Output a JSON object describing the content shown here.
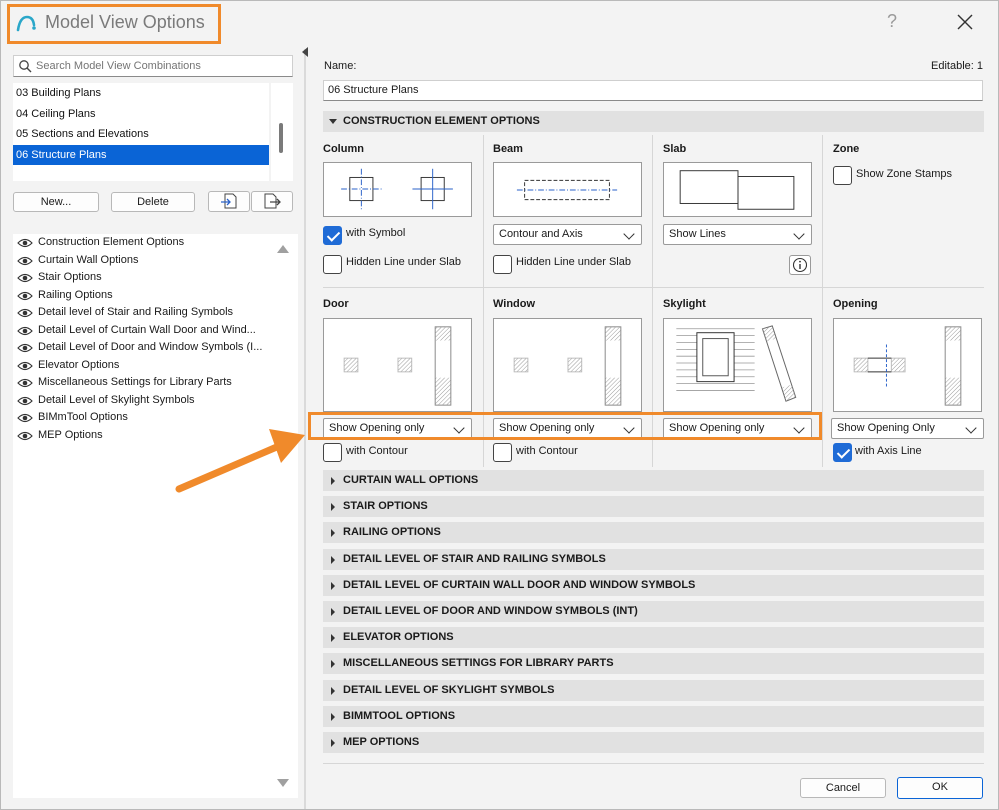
{
  "window": {
    "title": "Model View Options",
    "help_label": "?"
  },
  "search": {
    "placeholder": "Search Model View Combinations",
    "value": ""
  },
  "combinations": [
    {
      "label": "03 Building Plans",
      "selected": false
    },
    {
      "label": "04 Ceiling Plans",
      "selected": false
    },
    {
      "label": "05 Sections and Elevations",
      "selected": false
    },
    {
      "label": "06 Structure Plans",
      "selected": true
    }
  ],
  "buttons": {
    "new_label": "New...",
    "delete_label": "Delete",
    "import_icon": "import-icon",
    "export_icon": "export-icon"
  },
  "option_list": [
    "Construction Element Options",
    "Curtain Wall Options",
    "Stair Options",
    "Railing Options",
    "Detail level of Stair and Railing Symbols",
    "Detail Level of Curtain Wall Door and Wind...",
    "Detail Level of Door and Window Symbols (I...",
    "Elevator Options",
    "Miscellaneous Settings for Library Parts",
    "Detail Level of Skylight Symbols",
    "BIMmTool Options",
    "MEP Options"
  ],
  "name_label": "Name:",
  "editable_label": "Editable: 1",
  "name_value": "06 Structure Plans",
  "construction": {
    "header": "CONSTRUCTION ELEMENT OPTIONS",
    "column": {
      "title": "Column",
      "with_symbol": "with Symbol",
      "with_symbol_checked": true,
      "hidden_line": "Hidden Line under Slab",
      "hidden_line_checked": false
    },
    "beam": {
      "title": "Beam",
      "dropdown": "Contour and Axis",
      "hidden_line": "Hidden Line under Slab",
      "hidden_line_checked": false
    },
    "slab": {
      "title": "Slab",
      "dropdown": "Show Lines",
      "info_icon": "info-icon"
    },
    "zone": {
      "title": "Zone",
      "show_stamps": "Show Zone Stamps",
      "show_stamps_checked": false
    },
    "door": {
      "title": "Door",
      "dropdown": "Show Opening only",
      "with_contour": "with Contour",
      "with_contour_checked": false
    },
    "window": {
      "title": "Window",
      "dropdown": "Show Opening only",
      "with_contour": "with Contour",
      "with_contour_checked": false
    },
    "skylight": {
      "title": "Skylight",
      "dropdown": "Show Opening only"
    },
    "opening": {
      "title": "Opening",
      "dropdown": "Show Opening Only",
      "with_axis": "with Axis Line",
      "with_axis_checked": true
    }
  },
  "sections": [
    "CURTAIN WALL OPTIONS",
    "STAIR OPTIONS",
    "RAILING OPTIONS",
    "DETAIL LEVEL OF STAIR AND RAILING SYMBOLS",
    "DETAIL LEVEL OF CURTAIN WALL DOOR AND WINDOW SYMBOLS",
    "DETAIL LEVEL OF DOOR AND WINDOW SYMBOLS (INT)",
    "ELEVATOR OPTIONS",
    "MISCELLANEOUS SETTINGS FOR LIBRARY PARTS",
    "DETAIL LEVEL OF SKYLIGHT SYMBOLS",
    "BIMMTOOL OPTIONS",
    "MEP OPTIONS"
  ],
  "footer": {
    "cancel_label": "Cancel",
    "ok_label": "OK"
  },
  "colors": {
    "accent": "#0a64d6",
    "highlight": "#f08a2b",
    "section_bg": "#e1e1e1"
  }
}
